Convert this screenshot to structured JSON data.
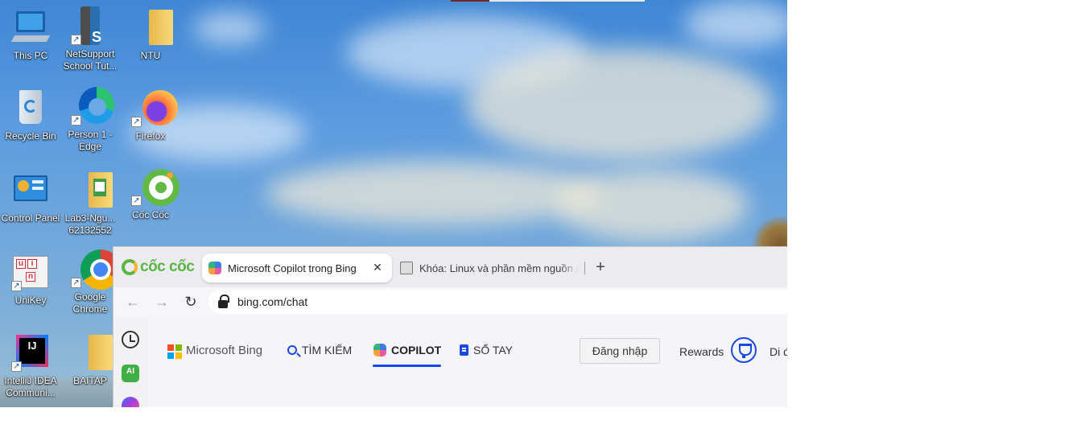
{
  "desktop": {
    "icons": [
      {
        "label": "This PC",
        "icon": "this-pc-icon"
      },
      {
        "label": "NetSupport School Tut...",
        "icon": "netsupport-icon"
      },
      {
        "label": "NTU",
        "icon": "folder-icon"
      },
      {
        "label": "Recycle Bin",
        "icon": "recycle-bin-icon"
      },
      {
        "label": "Person 1 - Edge",
        "icon": "edge-icon"
      },
      {
        "label": "Firefox",
        "icon": "firefox-icon"
      },
      {
        "label": "Control Panel",
        "icon": "control-panel-icon"
      },
      {
        "label": "Lab3-Ngu... 62132552",
        "icon": "folder-icon"
      },
      {
        "label": "Cốc Cốc",
        "icon": "coccoc-icon"
      },
      {
        "label": "UniKey",
        "icon": "unikey-icon"
      },
      {
        "label": "Google Chrome",
        "icon": "chrome-icon"
      },
      {
        "label": "IntelliJ IDEA Communi...",
        "icon": "intellij-icon"
      },
      {
        "label": "BAITAP",
        "icon": "folder-icon"
      }
    ]
  },
  "browser": {
    "brand": "cốc cốc",
    "tabs": [
      {
        "title": "Microsoft Copilot trong Bing",
        "active": true
      },
      {
        "title": "Khóa: Linux và phần mềm nguồn mở",
        "active": false
      }
    ],
    "address": "bing.com/chat",
    "new_tab": "+",
    "close_glyph": "✕"
  },
  "bing": {
    "logo_text": "Microsoft Bing",
    "nav": [
      {
        "label": "TÌM KIẾM",
        "icon": "search-icon"
      },
      {
        "label": "COPILOT",
        "icon": "copilot-icon",
        "active": true
      },
      {
        "label": "SỔ TAY",
        "icon": "notebook-icon"
      }
    ],
    "signin": "Đăng nhập",
    "rewards": "Rewards",
    "mobile": "Di đ",
    "accent": "#174ae4"
  },
  "sidebar": {
    "ai_label": "AI"
  }
}
